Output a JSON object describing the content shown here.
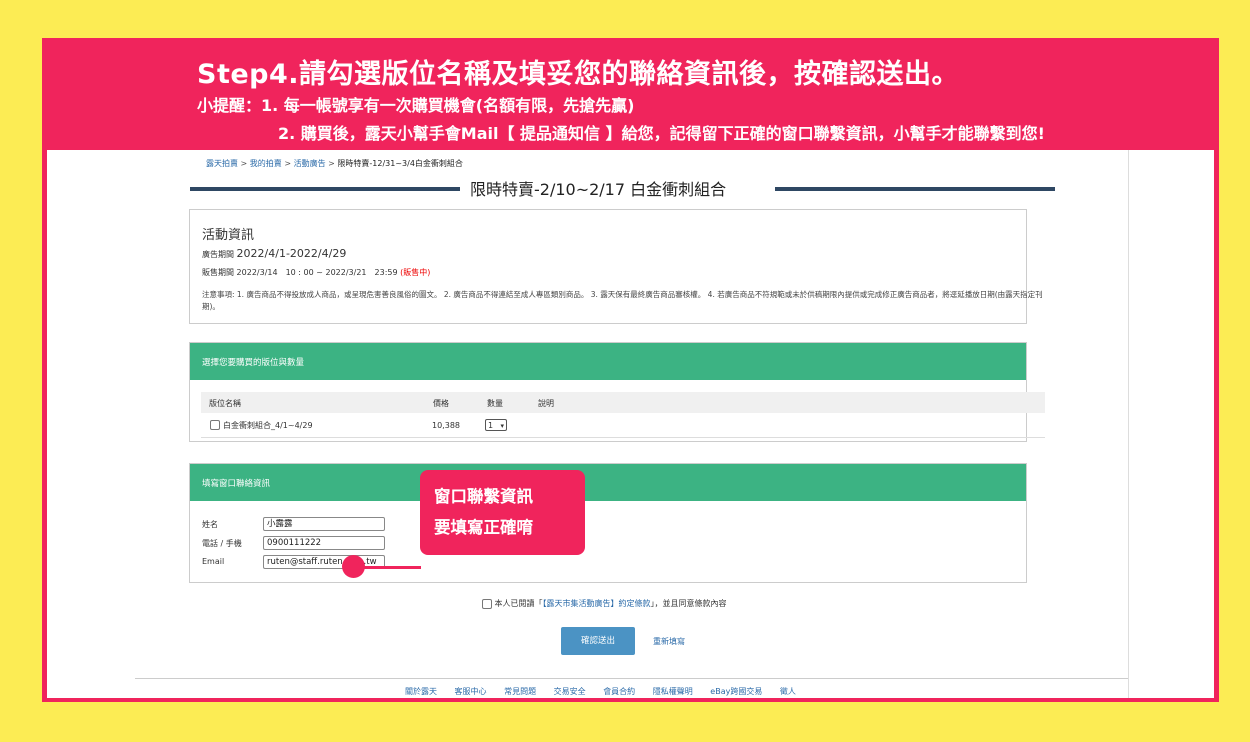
{
  "banner": {
    "title": "Step4.請勾選版位名稱及填妥您的聯絡資訊後，按確認送出。",
    "tip1": "小提醒：1. 每一帳號享有一次購買機會(名額有限，先搶先贏)",
    "tip2": "2. 購買後，露天小幫手會Mail【 提品通知信 】給您，記得留下正確的窗口聯繫資訊，小幫手才能聯繫到您!"
  },
  "breadcrumb": [
    "露天拍賣",
    "我的拍賣",
    "活動廣告",
    "限時特賣-12/31~3/4白金衝刺組合"
  ],
  "breadcrumb_sep": ">",
  "page_title": "限時特賣-2/10~2/17 白金衝刺組合",
  "activity": {
    "heading": "活動資訊",
    "ad_period_label": "廣告期間",
    "ad_period": "2022/4/1-2022/4/29",
    "sale_period_label": "販售期間",
    "sale_period": "2022/3/14　10 : 00 ~ 2022/3/21　23:59",
    "sale_status": "(販售中)",
    "notes": "注意事項: 1. 廣告商品不得投放成人商品，或呈現危害善良風俗的圖文。 2. 廣告商品不得連結至成人專區類別商品。 3. 露天保有最終廣告商品審核權。 4. 若廣告商品不符規範或未於供稿期限內提供或完成修正廣告商品者，將逕延播放日期(由露天指定刊期)。"
  },
  "select_section": {
    "header": "選擇您要購買的版位與數量",
    "columns": [
      "版位名稱",
      "價格",
      "數量",
      "說明"
    ],
    "rows": [
      {
        "name": "白金衝刺組合_4/1~4/29",
        "price": "10,388",
        "quantity": "1",
        "note": ""
      }
    ]
  },
  "contact_section": {
    "header": "填寫窗口聯絡資訊",
    "name_label": "姓名",
    "name_value": "小露露",
    "phone_label": "電話 / 手機",
    "phone_value": "0900111222",
    "email_label": "Email",
    "email_value": "ruten@staff.ruten.com.tw"
  },
  "callout": {
    "line1": "窗口聯繫資訊",
    "line2": "要填寫正確唷"
  },
  "agreement": {
    "prefix": "本人已閱讀「",
    "link": "【露天市集活動廣告】約定條款",
    "suffix": "」，並且同意條款內容"
  },
  "buttons": {
    "submit": "確認送出",
    "reset": "重新填寫"
  },
  "footer_links": [
    "關於露天",
    "客服中心",
    "常見問題",
    "交易安全",
    "會員合約",
    "隱私權聲明",
    "eBay跨國交易",
    "徵人"
  ],
  "colors": {
    "background": "#fcec54",
    "accent": "#f0245c",
    "section_header": "#3cb383",
    "title_rule": "#2e4763",
    "submit_button": "#4b93c4",
    "status_red": "#ee0000"
  }
}
